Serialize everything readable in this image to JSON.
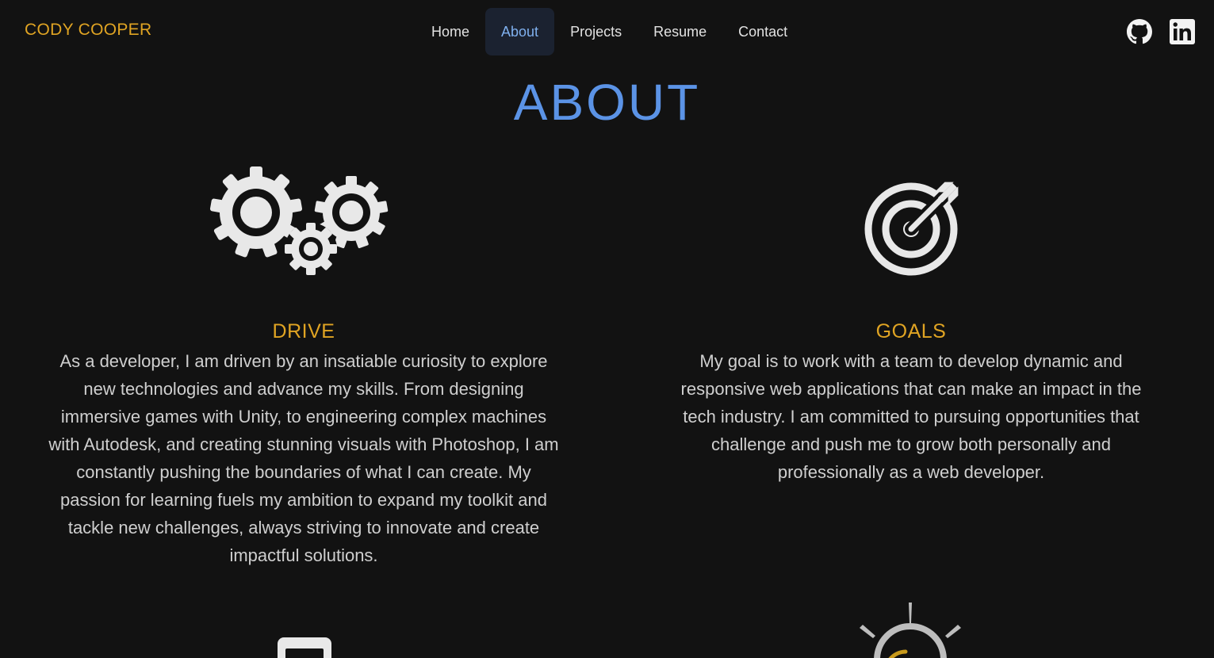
{
  "header": {
    "brand": "CODY COOPER",
    "nav": [
      {
        "label": "Home",
        "active": false
      },
      {
        "label": "About",
        "active": true
      },
      {
        "label": "Projects",
        "active": false
      },
      {
        "label": "Resume",
        "active": false
      },
      {
        "label": "Contact",
        "active": false
      }
    ],
    "social": [
      {
        "icon": "github-icon"
      },
      {
        "icon": "linkedin-icon"
      }
    ]
  },
  "page": {
    "title": "ABOUT"
  },
  "sections": {
    "drive": {
      "icon": "gears-icon",
      "heading": "DRIVE",
      "text": "As a developer, I am driven by an insatiable curiosity to explore new technologies and advance my skills. From designing immersive games with Unity, to engineering complex machines with Autodesk, and creating stunning visuals with Photoshop, I am constantly pushing the boundaries of what I can create. My passion for learning fuels my ambition to expand my toolkit and tackle new challenges, always striving to innovate and create impactful solutions."
    },
    "goals": {
      "icon": "target-arrow-icon",
      "heading": "GOALS",
      "text": "My goal is to work with a team to develop dynamic and responsive web applications that can make an impact in the tech industry. I am committed to pursuing opportunities that challenge and push me to grow both personally and professionally as a web developer."
    },
    "next_left": {
      "icon": "device-icon"
    },
    "next_right": {
      "icon": "lightbulb-icon"
    }
  },
  "colors": {
    "background": "#121212",
    "brand": "#e0a423",
    "title": "#5b93e6",
    "active_nav_bg": "#1b2230",
    "active_nav_text": "#7fb0ee",
    "body_text": "#cfcfcf",
    "icon": "#e8e8e8"
  }
}
